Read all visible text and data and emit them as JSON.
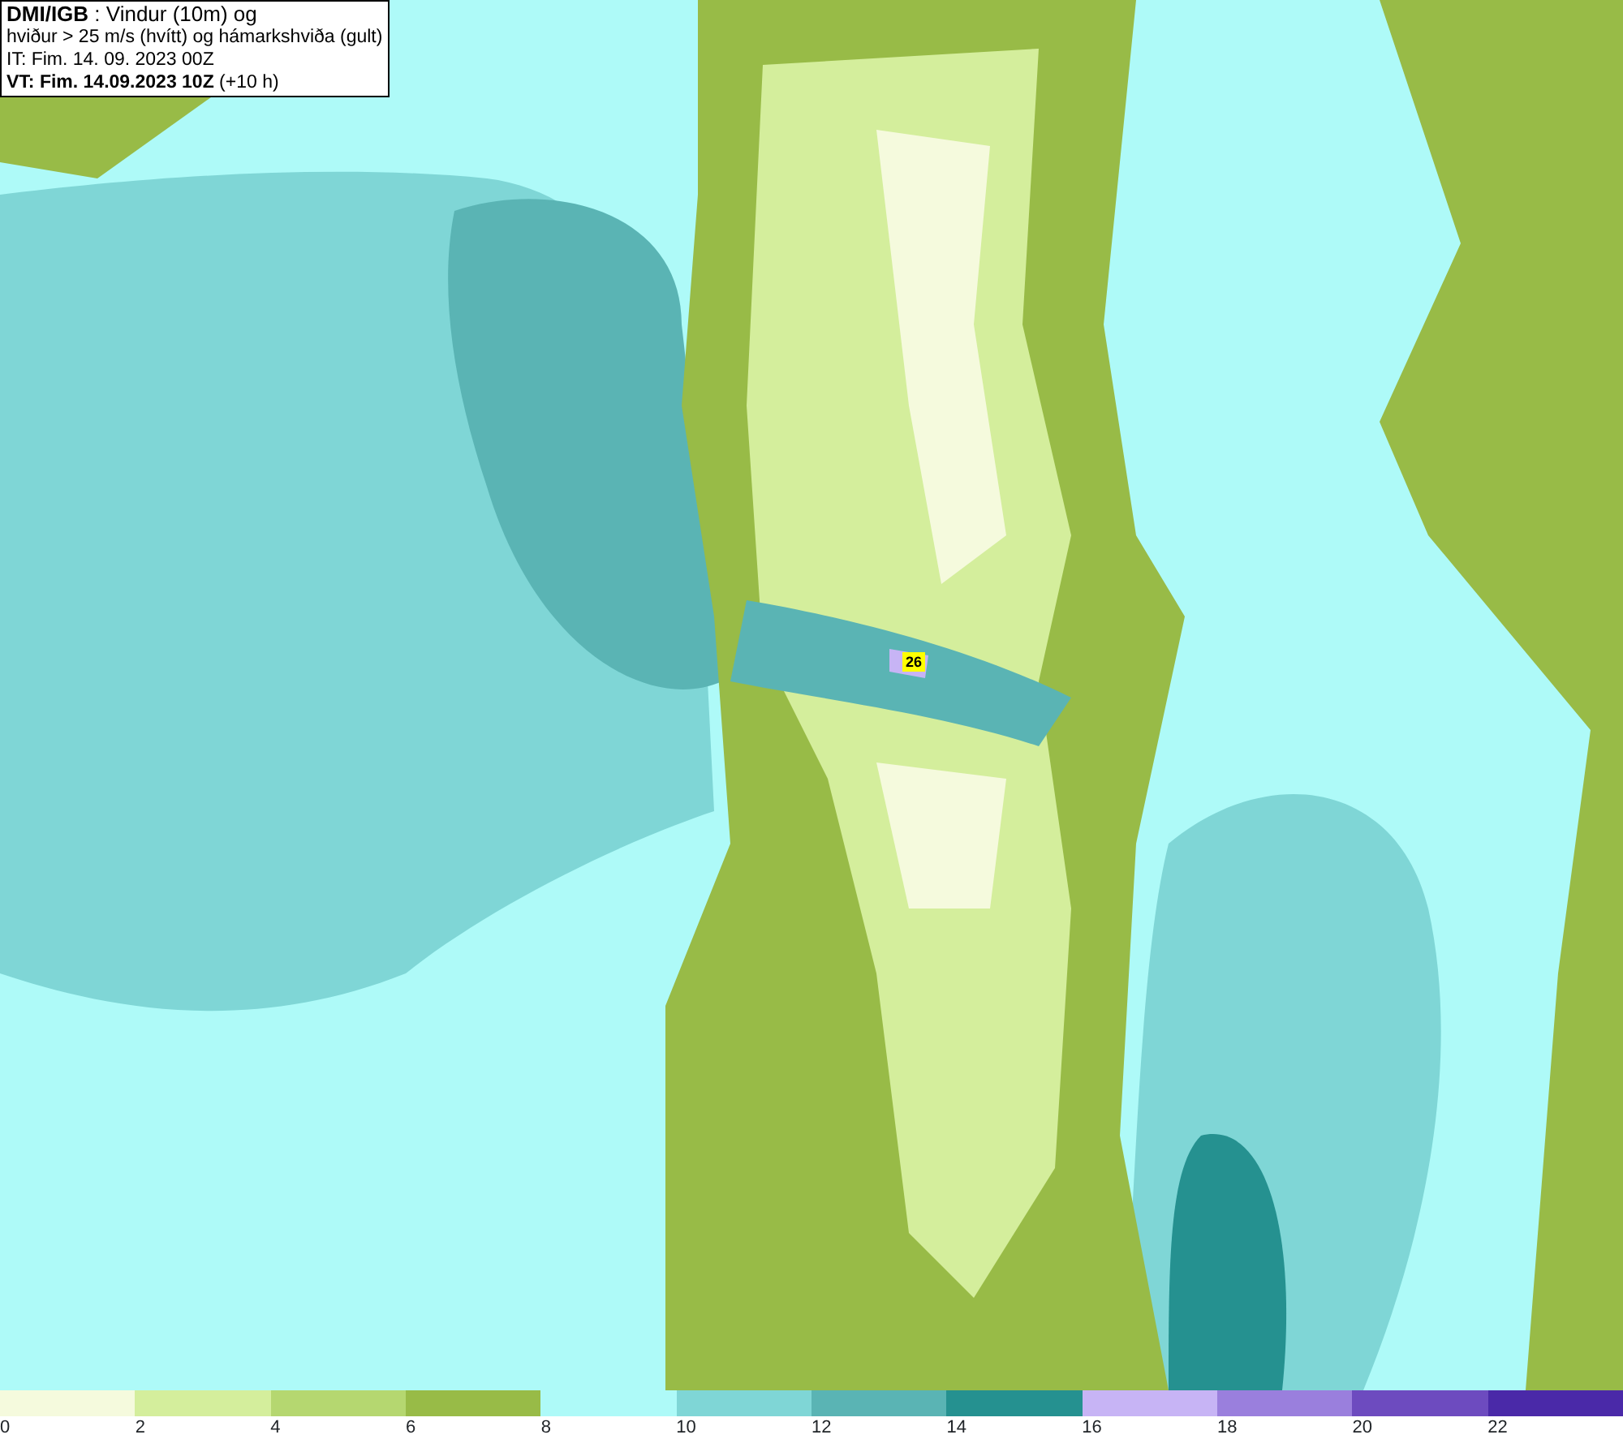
{
  "title_box": {
    "lines": [
      "**DMI/IGB** : Vindur (10m) og",
      "hviður > 25 m/s (hvítt) og hámarkshviða (gult)",
      "IT: Fim. 14. 09. 2023 00Z",
      "**VT: Fim. 14.09.2023 10Z** (+10 h)"
    ]
  },
  "map": {
    "gust_label": "26"
  },
  "legend": {
    "bins": [
      {
        "color": "#f5fadd",
        "label": "0"
      },
      {
        "color": "#d4ee9c",
        "label": "2"
      },
      {
        "color": "#b5d770",
        "label": "4"
      },
      {
        "color": "#98bb47",
        "label": "6"
      },
      {
        "color": "#aefaf8",
        "label": "8"
      },
      {
        "color": "#7fd6d6",
        "label": "10"
      },
      {
        "color": "#5ab4b4",
        "label": "12"
      },
      {
        "color": "#259190",
        "label": "14"
      },
      {
        "color": "#c7b4f5",
        "label": "16"
      },
      {
        "color": "#9a7fdd",
        "label": "18"
      },
      {
        "color": "#6d4bbf",
        "label": "20"
      },
      {
        "color": "#4a29a8",
        "label": "22"
      }
    ]
  }
}
